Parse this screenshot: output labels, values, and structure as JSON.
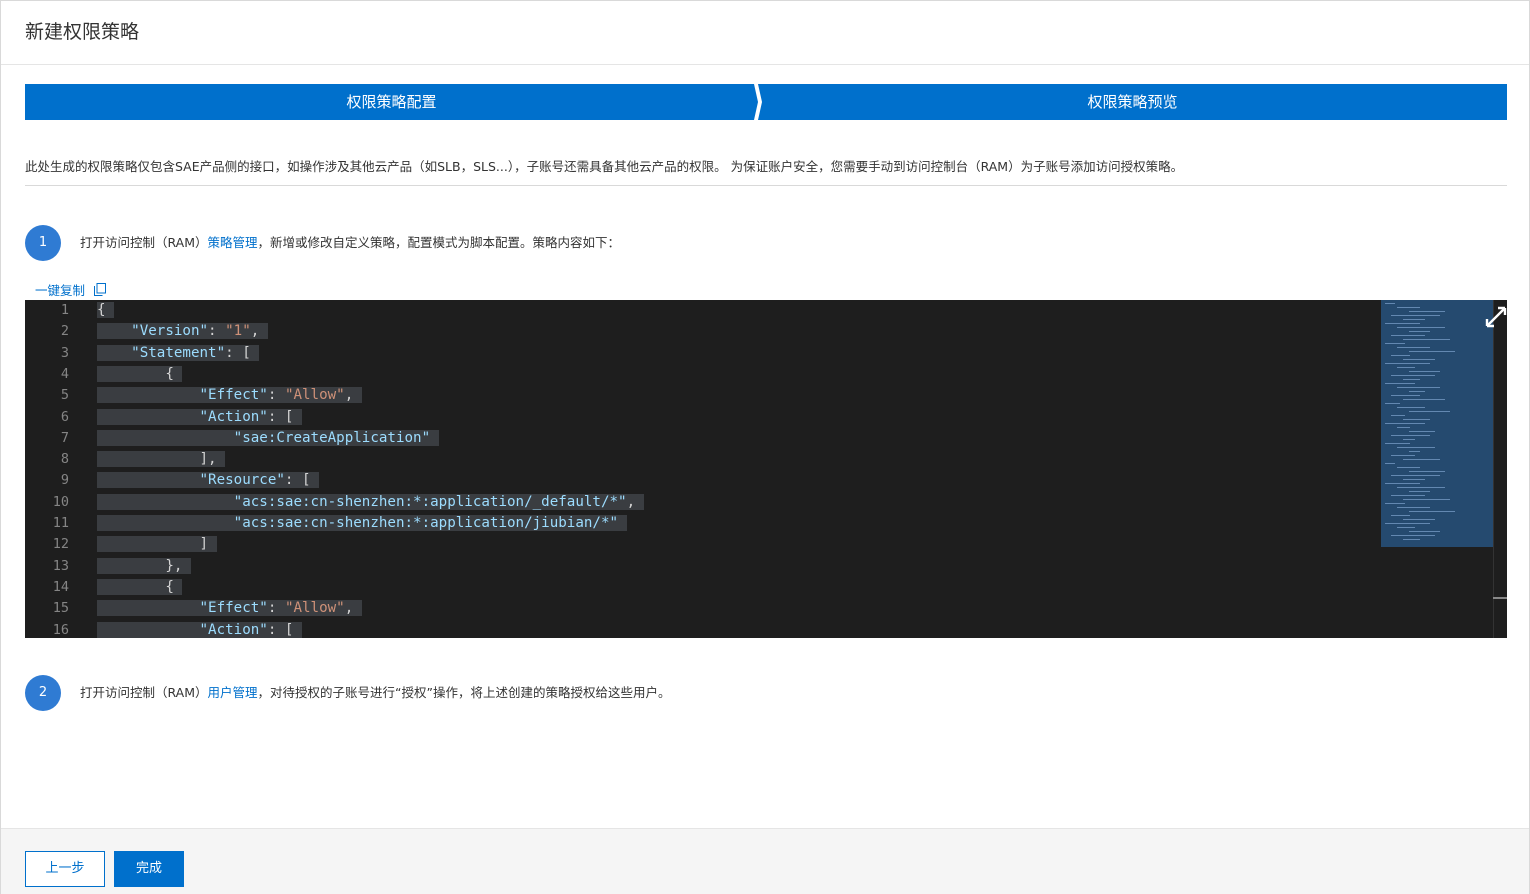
{
  "header": {
    "title": "新建权限策略"
  },
  "steps": [
    {
      "label": "权限策略配置"
    },
    {
      "label": "权限策略预览"
    }
  ],
  "notice": "此处生成的权限策略仅包含SAE产品侧的接口，如操作涉及其他云产品（如SLB，SLS...），子账号还需具备其他云产品的权限。 为保证账户安全，您需要手动到访问控制台（RAM）为子账号添加访问授权策略。",
  "step1": {
    "number": "1",
    "text_before": "打开访问控制（RAM）",
    "link": "策略管理",
    "text_after": "，新增或修改自定义策略，配置模式为脚本配置。策略内容如下："
  },
  "copy_label": "一键复制",
  "editor": {
    "lines": [
      {
        "n": "1",
        "indent": 0,
        "tokens": [
          [
            "pun",
            "{"
          ]
        ]
      },
      {
        "n": "2",
        "indent": 1,
        "tokens": [
          [
            "key",
            "\"Version\""
          ],
          [
            "pun",
            ": "
          ],
          [
            "str",
            "\"1\""
          ],
          [
            "pun",
            ","
          ]
        ]
      },
      {
        "n": "3",
        "indent": 1,
        "tokens": [
          [
            "key",
            "\"Statement\""
          ],
          [
            "pun",
            ": ["
          ]
        ]
      },
      {
        "n": "4",
        "indent": 2,
        "tokens": [
          [
            "pun",
            "{"
          ]
        ]
      },
      {
        "n": "5",
        "indent": 3,
        "tokens": [
          [
            "key",
            "\"Effect\""
          ],
          [
            "pun",
            ": "
          ],
          [
            "str",
            "\"Allow\""
          ],
          [
            "pun",
            ","
          ]
        ]
      },
      {
        "n": "6",
        "indent": 3,
        "tokens": [
          [
            "key",
            "\"Action\""
          ],
          [
            "pun",
            ": ["
          ]
        ]
      },
      {
        "n": "7",
        "indent": 4,
        "tokens": [
          [
            "key",
            "\"sae:CreateApplication\""
          ]
        ]
      },
      {
        "n": "8",
        "indent": 3,
        "tokens": [
          [
            "pun",
            "],"
          ]
        ]
      },
      {
        "n": "9",
        "indent": 3,
        "tokens": [
          [
            "key",
            "\"Resource\""
          ],
          [
            "pun",
            ": ["
          ]
        ]
      },
      {
        "n": "10",
        "indent": 4,
        "tokens": [
          [
            "key",
            "\"acs:sae:cn-shenzhen:*:application/_default/*\""
          ],
          [
            "pun",
            ","
          ]
        ]
      },
      {
        "n": "11",
        "indent": 4,
        "tokens": [
          [
            "key",
            "\"acs:sae:cn-shenzhen:*:application/jiubian/*\""
          ]
        ]
      },
      {
        "n": "12",
        "indent": 3,
        "tokens": [
          [
            "pun",
            "]"
          ]
        ]
      },
      {
        "n": "13",
        "indent": 2,
        "tokens": [
          [
            "pun",
            "},"
          ]
        ]
      },
      {
        "n": "14",
        "indent": 2,
        "tokens": [
          [
            "pun",
            "{"
          ]
        ]
      },
      {
        "n": "15",
        "indent": 3,
        "tokens": [
          [
            "key",
            "\"Effect\""
          ],
          [
            "pun",
            ": "
          ],
          [
            "str",
            "\"Allow\""
          ],
          [
            "pun",
            ","
          ]
        ]
      },
      {
        "n": "16",
        "indent": 3,
        "tokens": [
          [
            "key",
            "\"Action\""
          ],
          [
            "pun",
            ": ["
          ]
        ]
      }
    ],
    "colors": {
      "key": "#9cdcfe",
      "str": "#ce9178",
      "pun": "#d4d4d4",
      "background": "#1e1e1e",
      "selection": "#3a3d41"
    },
    "expand_icon": "expand-icon"
  },
  "step2": {
    "number": "2",
    "text_before": "打开访问控制（RAM）",
    "link": "用户管理",
    "text_after": "，对待授权的子账号进行“授权”操作，将上述创建的策略授权给这些用户。"
  },
  "footer": {
    "prev_label": "上一步",
    "done_label": "完成"
  },
  "accent_color": "#0070cc"
}
